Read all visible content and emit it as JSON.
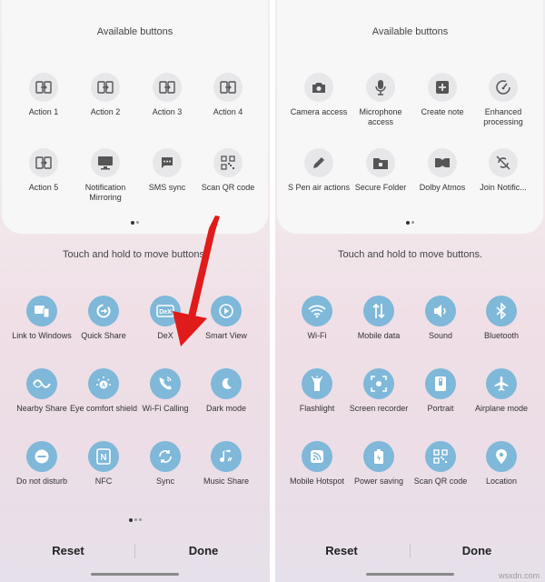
{
  "left": {
    "available_title": "Available buttons",
    "available": [
      {
        "label": "Action 1",
        "icon": "screen-swap-icon"
      },
      {
        "label": "Action 2",
        "icon": "screen-swap-icon"
      },
      {
        "label": "Action 3",
        "icon": "screen-swap-icon"
      },
      {
        "label": "Action 4",
        "icon": "screen-swap-icon"
      },
      {
        "label": "Action 5",
        "icon": "screen-swap-icon"
      },
      {
        "label": "Notification Mirroring",
        "icon": "monitor-icon"
      },
      {
        "label": "SMS sync",
        "icon": "message-icon"
      },
      {
        "label": "Scan QR code",
        "icon": "qr-icon"
      }
    ],
    "hint": "Touch and hold to move buttons.",
    "active": [
      {
        "label": "Link to Windows",
        "icon": "link-windows-icon"
      },
      {
        "label": "Quick Share",
        "icon": "quick-share-icon"
      },
      {
        "label": "DeX",
        "icon": "dex-icon"
      },
      {
        "label": "Smart View",
        "icon": "smart-view-icon"
      },
      {
        "label": "Nearby Share",
        "icon": "nearby-share-icon"
      },
      {
        "label": "Eye comfort shield",
        "icon": "eye-comfort-icon"
      },
      {
        "label": "Wi-Fi Calling",
        "icon": "wifi-calling-icon"
      },
      {
        "label": "Dark mode",
        "icon": "moon-icon"
      },
      {
        "label": "Do not disturb",
        "icon": "minus-circle-icon"
      },
      {
        "label": "NFC",
        "icon": "nfc-icon"
      },
      {
        "label": "Sync",
        "icon": "sync-icon"
      },
      {
        "label": "Music Share",
        "icon": "music-icon"
      }
    ],
    "reset": "Reset",
    "done": "Done"
  },
  "right": {
    "available_title": "Available buttons",
    "available": [
      {
        "label": "Camera access",
        "icon": "camera-icon"
      },
      {
        "label": "Microphone access",
        "icon": "microphone-icon"
      },
      {
        "label": "Create note",
        "icon": "create-note-icon"
      },
      {
        "label": "Enhanced processing",
        "icon": "gauge-icon"
      },
      {
        "label": "S Pen air actions",
        "icon": "pen-icon"
      },
      {
        "label": "Secure Folder",
        "icon": "folder-icon"
      },
      {
        "label": "Dolby Atmos",
        "icon": "dolby-icon"
      },
      {
        "label": "Join Notific...",
        "icon": "join-icon"
      }
    ],
    "hint": "Touch and hold to move buttons.",
    "active": [
      {
        "label": "Wi-Fi",
        "icon": "wifi-icon"
      },
      {
        "label": "Mobile data",
        "icon": "mobile-data-icon"
      },
      {
        "label": "Sound",
        "icon": "sound-icon"
      },
      {
        "label": "Bluetooth",
        "icon": "bluetooth-icon"
      },
      {
        "label": "Flashlight",
        "icon": "flashlight-icon"
      },
      {
        "label": "Screen recorder",
        "icon": "screen-recorder-icon"
      },
      {
        "label": "Portrait",
        "icon": "portrait-icon"
      },
      {
        "label": "Airplane mode",
        "icon": "airplane-icon"
      },
      {
        "label": "Mobile Hotspot",
        "icon": "hotspot-icon"
      },
      {
        "label": "Power saving",
        "icon": "power-saving-icon"
      },
      {
        "label": "Scan QR code",
        "icon": "qr-icon"
      },
      {
        "label": "Location",
        "icon": "location-icon"
      }
    ],
    "reset": "Reset",
    "done": "Done"
  },
  "watermark": "wsxdn.com",
  "colors": {
    "active_button": "#7fb8d9",
    "available_button": "#e7e7e9",
    "arrow": "#e01b1b"
  }
}
